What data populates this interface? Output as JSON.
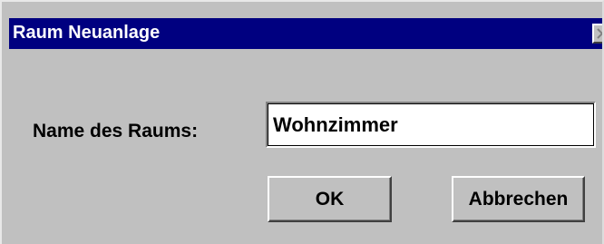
{
  "window": {
    "title": "Raum Neuanlage"
  },
  "form": {
    "room_name_label": "Name des Raums:",
    "room_name_value": "Wohnzimmer"
  },
  "buttons": {
    "ok_label": "OK",
    "cancel_label": "Abbrechen"
  },
  "colors": {
    "titlebar": "#000080",
    "dialog_face": "#c0c0c0"
  },
  "icons": {
    "close": "close-icon"
  }
}
